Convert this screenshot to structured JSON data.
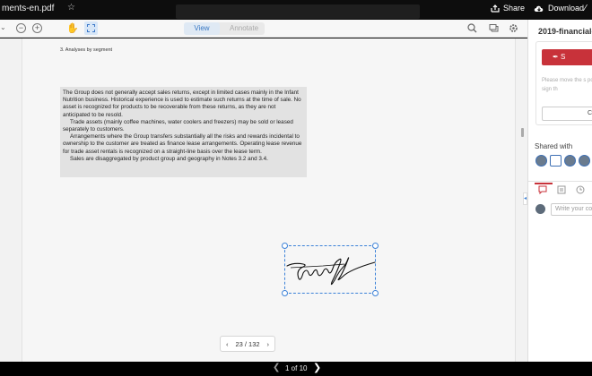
{
  "topbar": {
    "file_title": "ments-en.pdf",
    "star_glyph": "☆",
    "share_label": "Share",
    "download_label": "Download"
  },
  "toolbar": {
    "view_label": "View",
    "annotate_label": "Annotate",
    "icons": [
      "chevron-down-icon",
      "zoom-out-icon",
      "zoom-in-icon",
      "hand-icon",
      "select-area-icon",
      "search-icon",
      "comments-icon",
      "settings-icon"
    ]
  },
  "document": {
    "heading": "3. Analyses by segment",
    "paragraphs": [
      "The Group does not generally accept sales returns, except in limited cases mainly in the Infant Nutrition business. Historical experience is used to estimate such returns at the time of sale. No asset is recognized for products to be recoverable from these returns, as they are not anticipated to be resold.",
      "Trade assets (mainly coffee machines, water coolers and freezers) may be sold or leased separately to customers.",
      "Arrangements where the Group transfers substantially all the risks and rewards incidental to ownership to the customer are treated as finance lease arrangements. Operating lease revenue for trade asset rentals is recognized on a straight-line basis over the lease term.",
      "Sales are disaggregated by product group and geography in Notes 3.2 and 3.4."
    ]
  },
  "pager": {
    "prev": "‹",
    "label": "23 / 132",
    "next": "›"
  },
  "sidebar": {
    "title": "2019-financial-s",
    "sign_label": "S",
    "sign_hint": "Please move the s position to sign th",
    "cancel_label": "C",
    "shared_with_label": "Shared with",
    "comment_placeholder": "Write your co",
    "accent_color": "#c8323a"
  },
  "bottombar": {
    "prev": "❮",
    "page_label": "1 of 10",
    "next": "❯"
  }
}
